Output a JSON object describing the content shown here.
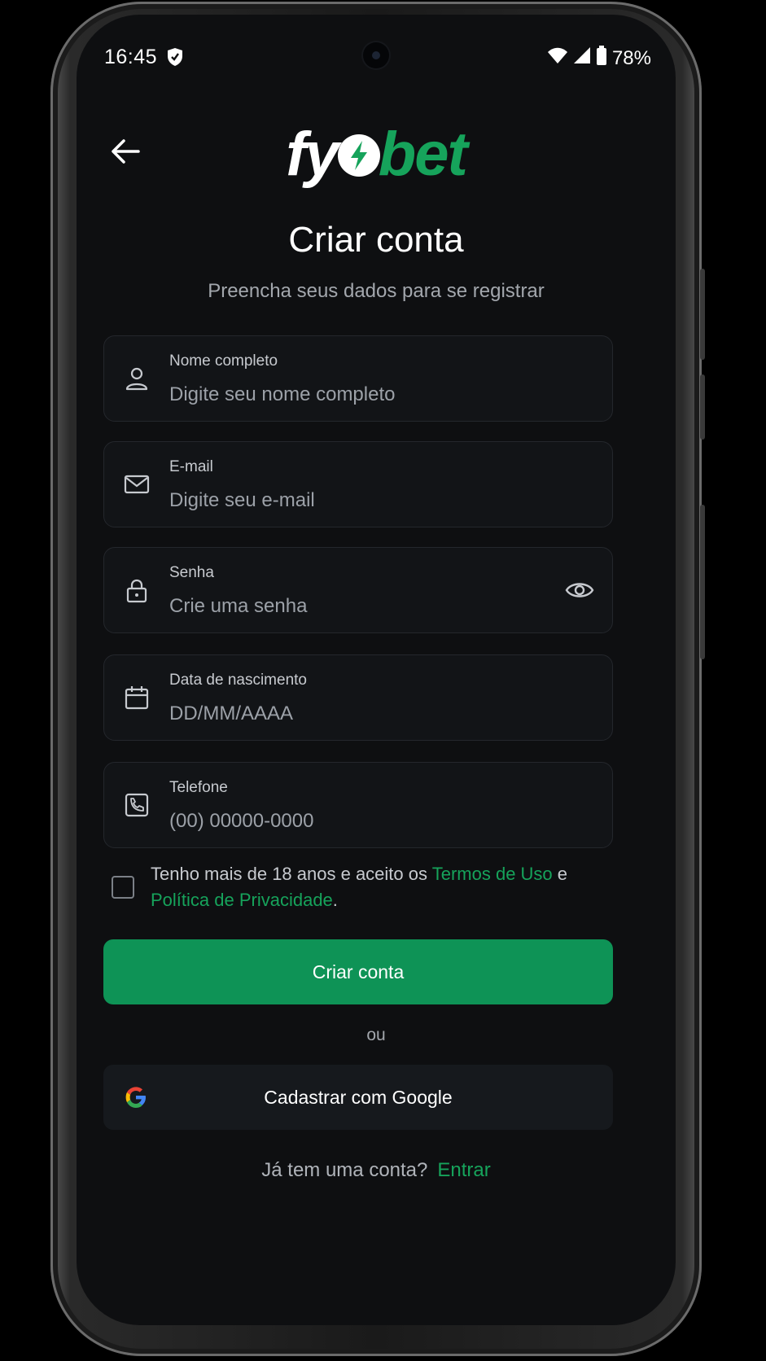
{
  "status": {
    "time": "16:45",
    "battery": "78%"
  },
  "brand": {
    "part1": "fy",
    "part2": "bet",
    "accent": "#16a35b"
  },
  "header": {
    "title": "Criar conta",
    "subtitle": "Preencha seus dados para se registrar"
  },
  "fields": [
    {
      "label": "Nome completo",
      "placeholder": "Digite seu nome completo",
      "icon": "user-icon"
    },
    {
      "label": "E-mail",
      "placeholder": "Digite seu e-mail",
      "icon": "mail-icon"
    },
    {
      "label": "Senha",
      "placeholder": "Crie uma senha",
      "icon": "lock-icon"
    },
    {
      "label": "Data de nascimento",
      "placeholder": "DD/MM/AAAA",
      "icon": "calendar-icon"
    },
    {
      "label": "Telefone",
      "placeholder": "(00) 00000-0000",
      "icon": "phone-icon"
    }
  ],
  "terms": {
    "prefix": "Tenho mais de 18 anos e aceito os ",
    "terms_link": "Termos de Uso",
    "middle": " e ",
    "privacy_link": "Política de Privacidade",
    "suffix": "."
  },
  "actions": {
    "create": "Criar conta",
    "or": "ou",
    "google": "Cadastrar com Google"
  },
  "footer": {
    "question": "Já tem uma conta?",
    "link": "Entrar"
  }
}
